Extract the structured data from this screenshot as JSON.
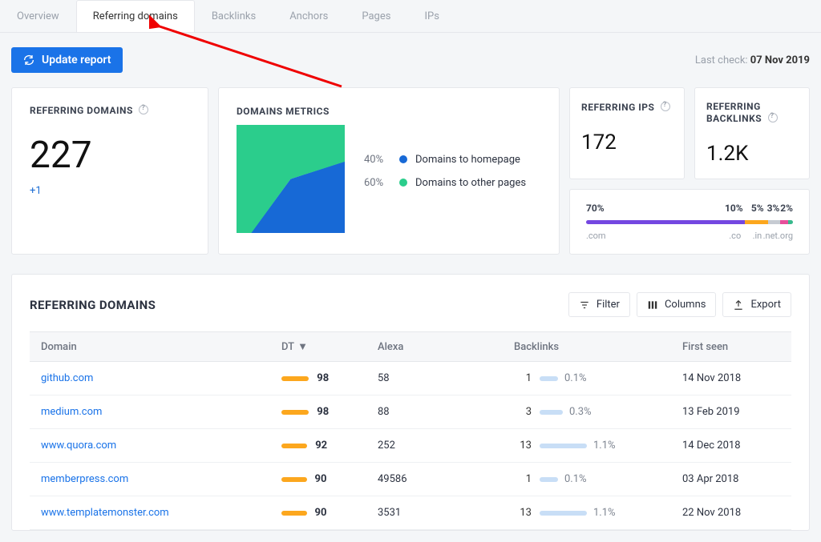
{
  "tabs": [
    "Overview",
    "Referring domains",
    "Backlinks",
    "Anchors",
    "Pages",
    "IPs"
  ],
  "activeTab": 1,
  "updateButton": "Update report",
  "lastCheck": {
    "label": "Last check: ",
    "value": "07 Nov 2019"
  },
  "cards": {
    "refDomains": {
      "title": "REFERRING DOMAINS",
      "value": "227",
      "delta": "+1"
    },
    "domMetrics": {
      "title": "DOMAINS METRICS"
    },
    "refIps": {
      "title": "REFERRING IPS",
      "value": "172"
    },
    "refBacklinks": {
      "title": "REFERRING BACKLINKS",
      "value": "1.2K"
    }
  },
  "chart_data": {
    "type": "pie",
    "title": "DOMAINS METRICS",
    "slices": [
      {
        "label": "Domains to homepage",
        "value": 40,
        "color": "#1769d6"
      },
      {
        "label": "Domains to other pages",
        "value": 60,
        "color": "#2bcd8c"
      }
    ]
  },
  "distribution": {
    "segments": [
      {
        "pct": "70%",
        "label": ".com",
        "color": "#7447e1",
        "w": 63
      },
      {
        "pct": "10%",
        "label": ".co",
        "color": "#fca71e",
        "w": 9
      },
      {
        "pct": "5%",
        "label": ".in",
        "color": "#c6cbd2",
        "w": 5
      },
      {
        "pct": "3%",
        "label": ".net",
        "color": "#e74f9b",
        "w": 3
      },
      {
        "pct": "2%",
        "label": ".org",
        "color": "#37b98c",
        "w": 2
      }
    ]
  },
  "tableTitle": "REFERRING DOMAINS",
  "tableActions": {
    "filter": "Filter",
    "columns": "Columns",
    "export": "Export"
  },
  "columns": [
    "Domain",
    "DT",
    "Alexa",
    "Backlinks",
    "First seen"
  ],
  "sortIndicator": "▼",
  "rows": [
    {
      "domain": "github.com",
      "dt": 98,
      "alexa": "58",
      "bl": 1,
      "blp": "0.1%",
      "first": "14 Nov 2018"
    },
    {
      "domain": "medium.com",
      "dt": 98,
      "alexa": "88",
      "bl": 3,
      "blp": "0.3%",
      "first": "13 Feb 2019"
    },
    {
      "domain": "www.quora.com",
      "dt": 92,
      "alexa": "252",
      "bl": 13,
      "blp": "1.1%",
      "first": "14 Dec 2018"
    },
    {
      "domain": "memberpress.com",
      "dt": 90,
      "alexa": "49586",
      "bl": 1,
      "blp": "0.1%",
      "first": "03 Apr 2018"
    },
    {
      "domain": "www.templatemonster.com",
      "dt": 90,
      "alexa": "3531",
      "bl": 13,
      "blp": "1.1%",
      "first": "22 Nov 2018"
    }
  ]
}
